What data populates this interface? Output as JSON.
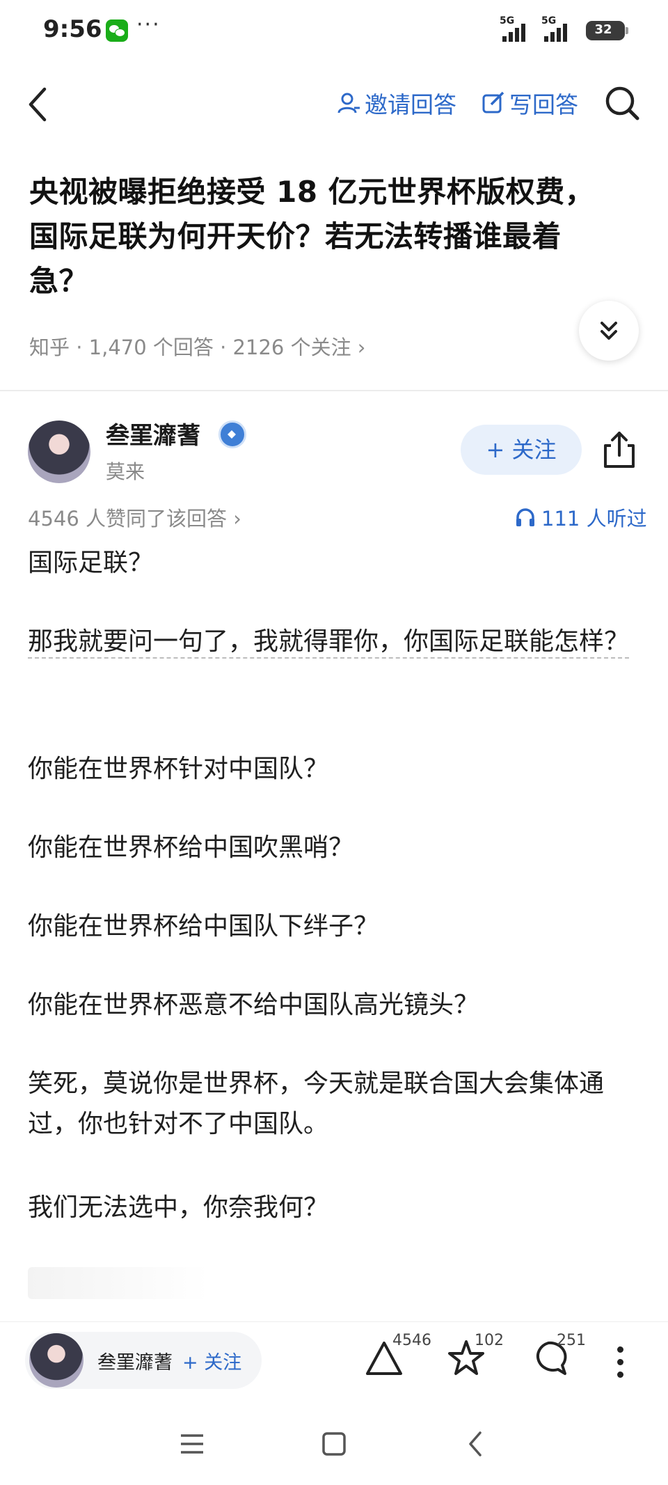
{
  "status_bar": {
    "time": "9:56",
    "dots": "···",
    "network_1": "5G",
    "network_2": "5G",
    "battery": "32"
  },
  "nav": {
    "invite_label": "邀请回答",
    "write_label": "写回答"
  },
  "question": {
    "title": "央视被曝拒绝接受 18 亿元世界杯版权费，国际足联为何开天价？若无法转播谁最着急？",
    "meta": "知乎 · 1,470 个回答 · 2126 个关注 ›"
  },
  "author": {
    "name": "叁罣灖蓍",
    "subtitle": "莫来",
    "follow_label": "+ 关注"
  },
  "answer_stats": {
    "votes_text": "4546 人赞同了该回答 ›",
    "listen_text": "111 人听过"
  },
  "content": {
    "paragraphs": [
      "国际足联？",
      "那我就要问一句了，我就得罪你，你国际足联能怎样？",
      "你能在世界杯针对中国队？",
      "你能在世界杯给中国吹黑哨？",
      "你能在世界杯给中国队下绊子？",
      "你能在世界杯恶意不给中国队高光镜头？",
      "笑死，莫说你是世界杯，今天就是联合国大会集体通过，你也针对不了中国队。",
      "我们无法选中，你奈我何？"
    ]
  },
  "bottom_bar": {
    "author_name": "叁罣灖蓍",
    "follow_label": "+ 关注",
    "upvotes": "4546",
    "favorites": "102",
    "comments": "251"
  },
  "colors": {
    "accent": "#2d69c9",
    "text": "#1a1a1a",
    "muted": "#8a8a8a"
  },
  "icons": [
    "wechat-icon",
    "back-icon",
    "invite-icon",
    "edit-icon",
    "search-icon",
    "chevron-double-down-icon",
    "verified-icon",
    "share-icon",
    "headphones-icon",
    "upvote-icon",
    "star-icon",
    "comment-icon",
    "more-vertical-icon",
    "menu-icon",
    "home-square-icon",
    "system-back-icon"
  ]
}
